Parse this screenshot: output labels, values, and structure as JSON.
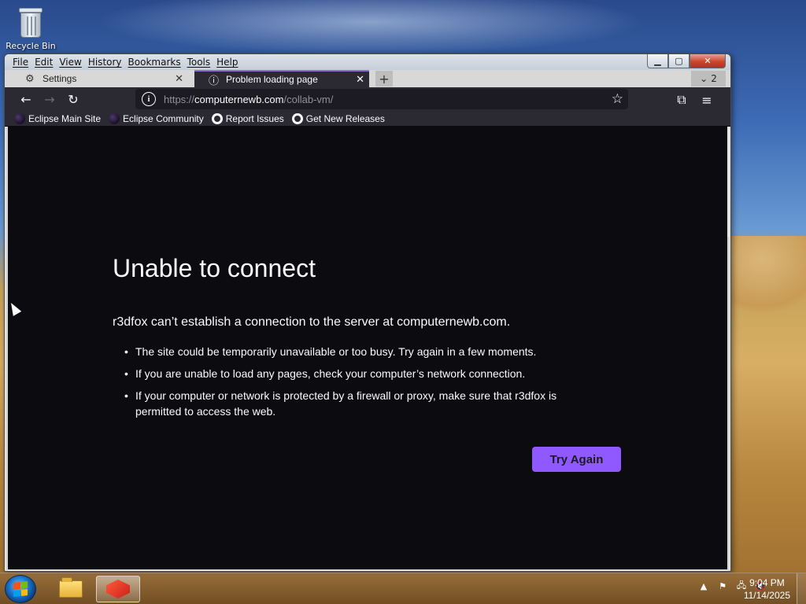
{
  "desktop": {
    "icons": [
      {
        "label": "Recycle Bin",
        "icon": "recycle-bin-icon"
      }
    ]
  },
  "window": {
    "menu": [
      "File",
      "Edit",
      "View",
      "History",
      "Bookmarks",
      "Tools",
      "Help"
    ],
    "controls": {
      "minimize": "▁",
      "maximize": "▢",
      "close": "✕"
    }
  },
  "tabs": [
    {
      "title": "Settings",
      "icon": "gear-icon",
      "active": false
    },
    {
      "title": "Problem loading page",
      "icon": "info-icon",
      "active": true
    }
  ],
  "tab_list_count": "2",
  "toolbar": {
    "url_prefix": "https://",
    "url_host": "computernewb.com",
    "url_path": "/collab-vm/"
  },
  "bookmarks": [
    {
      "label": "Eclipse Main Site",
      "icon": "eclipse-icon"
    },
    {
      "label": "Eclipse Community",
      "icon": "eclipse-icon"
    },
    {
      "label": "Report Issues",
      "icon": "github-icon"
    },
    {
      "label": "Get New Releases",
      "icon": "github-icon"
    }
  ],
  "error_page": {
    "title": "Unable to connect",
    "description": "r3dfox can’t establish a connection to the server at computernewb.com.",
    "items": [
      "The site could be temporarily unavailable or too busy. Try again in a few moments.",
      "If you are unable to load any pages, check your computer’s network connection.",
      "If your computer or network is protected by a firewall or proxy, make sure that r3dfox is permitted to access the web."
    ],
    "button": "Try Again"
  },
  "taskbar": {
    "time": "9:04 PM",
    "date": "11/14/2025"
  },
  "colors": {
    "accent": "#9059ff",
    "page_bg": "#0c0b0f",
    "toolbar_bg": "#2b2a33"
  }
}
